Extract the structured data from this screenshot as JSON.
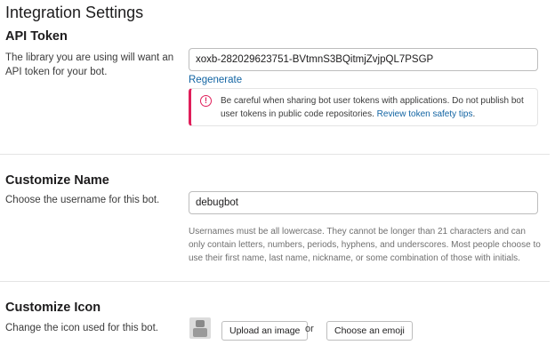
{
  "page": {
    "title": "Integration Settings"
  },
  "api_token": {
    "title": "API Token",
    "description": "The library you are using will want an API token for your bot.",
    "value": "xoxb-282029623751-BVtmnS3BQitmjZvjpQL7PSGP",
    "regenerate_label": "Regenerate",
    "warning": {
      "text": "Be careful when sharing bot user tokens with applications. Do not publish bot user tokens in public code repositories.",
      "link": "Review token safety tips",
      "end": "."
    }
  },
  "customize_name": {
    "title": "Customize Name",
    "description": "Choose the username for this bot.",
    "value": "debugbot",
    "hint": "Usernames must be all lowercase. They cannot be longer than 21 characters and can only contain letters, numbers, periods, hyphens, and underscores. Most people choose to use their first name, last name, nickname, or some combination of those with initials."
  },
  "customize_icon": {
    "title": "Customize Icon",
    "description": "Change the icon used for this bot.",
    "upload_label": "Upload an image",
    "or_label": "or",
    "emoji_label": "Choose an emoji"
  },
  "colors": {
    "link": "#1264a3",
    "warning_accent": "#e01e5a"
  },
  "icons": {
    "warning": "warning-circle-icon",
    "bot_avatar": "bot-avatar-icon"
  }
}
